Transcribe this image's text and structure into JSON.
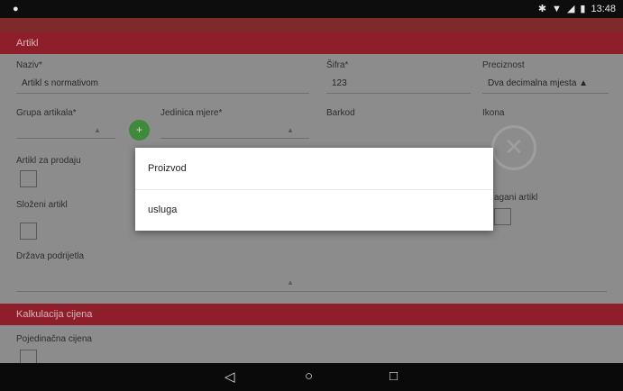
{
  "status_bar": {
    "time": "13:48",
    "icons": [
      "app-icon",
      "bluetooth-icon",
      "wifi-icon",
      "signal-icon",
      "battery-icon"
    ]
  },
  "section_artikl": "Artikl",
  "fields": {
    "naziv": {
      "label": "Naziv*",
      "value": "Artikl s normativom"
    },
    "sifra": {
      "label": "Šifra*",
      "value": "123"
    },
    "preciznost": {
      "label": "Preciznost",
      "value": "Dva decimalna mjesta ▲"
    },
    "grupa": {
      "label": "Grupa artikala*"
    },
    "jedinica": {
      "label": "Jedinica mjere*"
    },
    "barkod": {
      "label": "Barkod"
    },
    "ikona": {
      "label": "Ikona"
    },
    "artikl_za_prodaju": {
      "label": "Artikl za prodaju"
    },
    "slozeni_artikl": {
      "label": "Složeni artikl"
    },
    "vagani_artikl": {
      "label": "agani artikl"
    },
    "drzava": {
      "label": "Država podrijetla"
    }
  },
  "section_kalkulacija": "Kalkulacija cijena",
  "pojedinacna": {
    "label": "Pojedinačna cijena"
  },
  "dialog": {
    "options": [
      "Proizvod",
      "usluga"
    ]
  },
  "nav": {
    "back": "◁",
    "home": "○",
    "recents": "□"
  }
}
